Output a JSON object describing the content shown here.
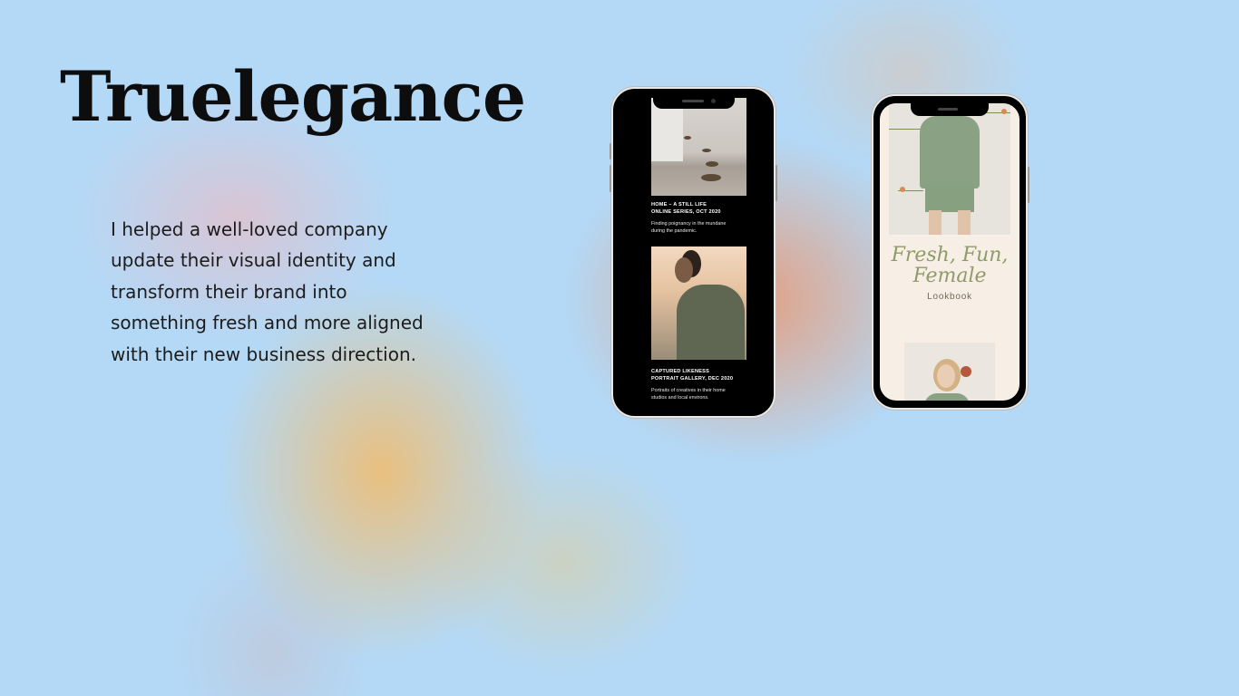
{
  "title": "Truelegance",
  "description": "I helped a well-loved company update their visual identity and transform their brand into something fresh and more aligned with their new business direction.",
  "phone_dark": {
    "item1_title_line1": "HOME – A STILL LIFE",
    "item1_title_line2": "ONLINE SERIES, OCT 2020",
    "item1_text_line1": "Finding poignancy in the mundane",
    "item1_text_line2": "during the pandemic.",
    "item2_title_line1": "CAPTURED LIKENESS",
    "item2_title_line2": "PORTRAIT GALLERY, DEC 2020",
    "item2_text_line1": "Portraits of creatives in their home",
    "item2_text_line2": "studios and local environs."
  },
  "phone_light": {
    "headline_line1": "Fresh, Fun,",
    "headline_line2": "Female",
    "subtitle": "Lookbook"
  },
  "colors": {
    "background": "#b3d9f7",
    "headline_green": "#8f9b68",
    "screen_cream": "#f7efe6"
  }
}
